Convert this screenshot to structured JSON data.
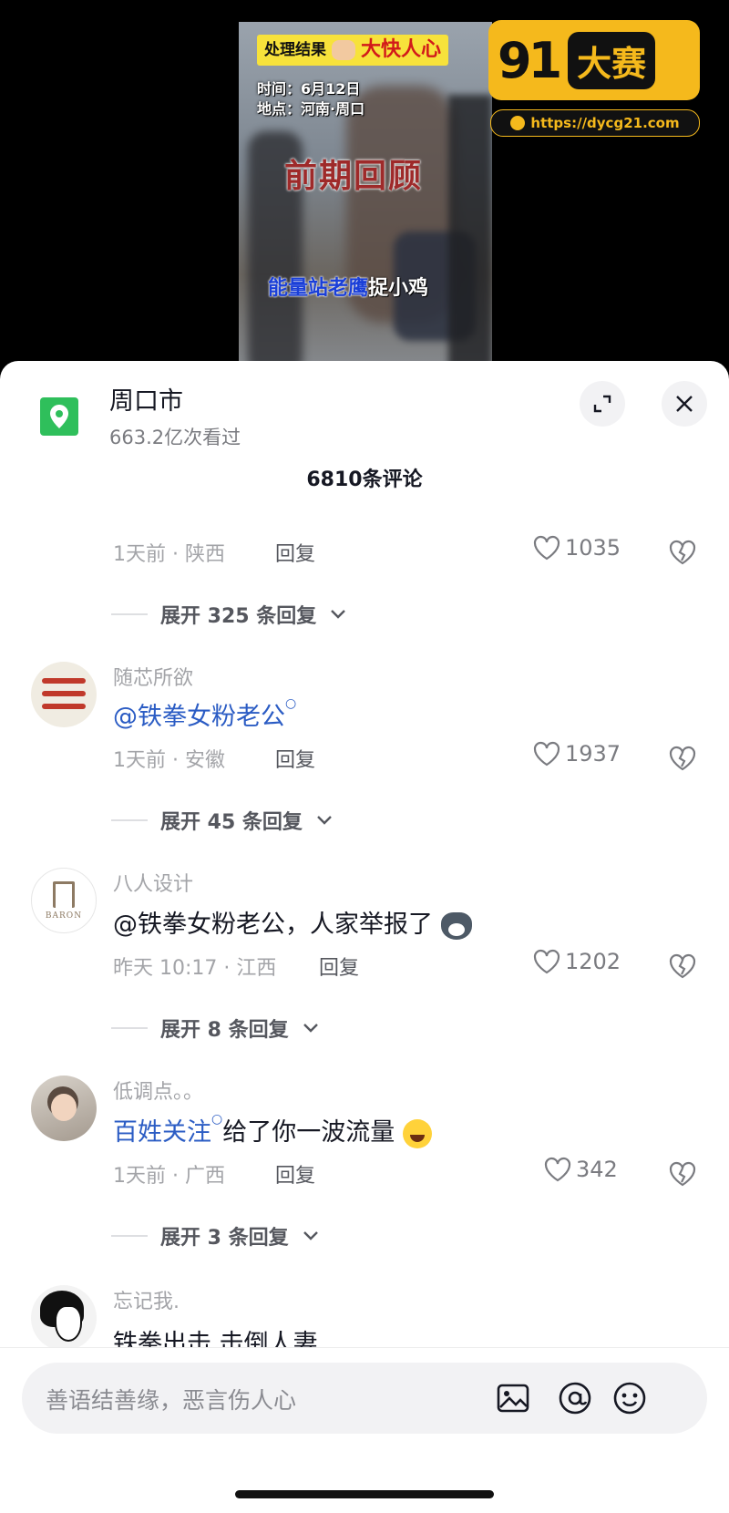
{
  "video": {
    "result_label": "处理结果",
    "result_value": "大快人心",
    "time_line": "时间：6月12日",
    "place_line": "地点：河南·周口",
    "review_title": "前期回顾",
    "caption_highlight": "能量站老鹰",
    "caption_rest": "捉小鸡",
    "watermark": {
      "logo": "91",
      "title": "大赛",
      "url": "https://dycg21.com"
    }
  },
  "header": {
    "location_name": "周口市",
    "views": "663.2亿次看过",
    "comment_count": "6810条评论"
  },
  "comments": [
    {
      "meta": "1天前 · 陕西",
      "reply": "回复",
      "likes": "1035",
      "expand": "展开 325 条回复"
    },
    {
      "username": "随芯所欲",
      "mention": "@铁拳女粉老公",
      "text": "",
      "meta": "1天前 · 安徽",
      "reply": "回复",
      "likes": "1937",
      "expand": "展开 45 条回复"
    },
    {
      "username": "八人设计",
      "mention": "@铁拳女粉老公",
      "text": "，人家举报了",
      "meta": "昨天 10:17 · 江西",
      "reply": "回复",
      "likes": "1202",
      "expand": "展开 8 条回复",
      "avatar_text": "BARON"
    },
    {
      "username": "低调点。。",
      "mention": "百姓关注",
      "text": "给了你一波流量",
      "meta": "1天前 · 广西",
      "reply": "回复",
      "likes": "342",
      "expand": "展开 3 条回复"
    },
    {
      "username": "忘记我.",
      "text": "铁拳出击 击倒人妻"
    }
  ],
  "input": {
    "placeholder": "善语结善缘，恶言伤人心"
  },
  "colors": {
    "accent_link": "#2b5cc4",
    "location_green": "#2fbf5b",
    "watermark_yellow": "#f5b91c"
  },
  "icons": [
    "location-pin-icon",
    "expand-icon",
    "close-icon",
    "heart-icon",
    "broken-heart-icon",
    "chevron-down-icon",
    "image-icon",
    "at-icon",
    "emoji-icon"
  ]
}
